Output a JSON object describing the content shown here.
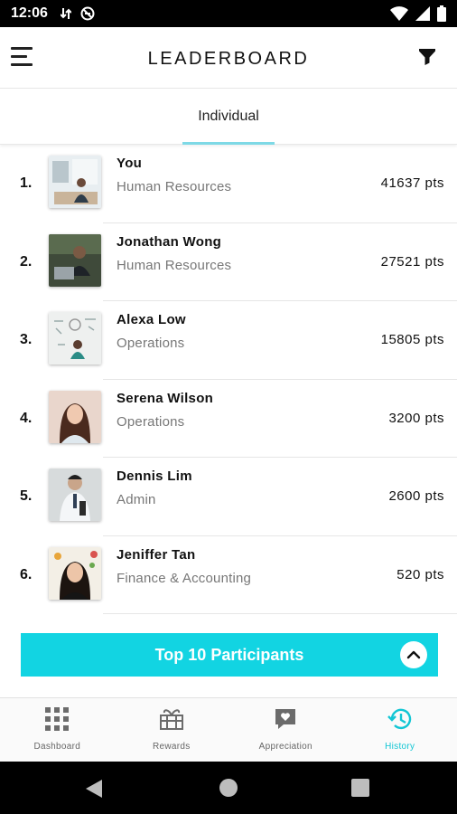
{
  "status_bar": {
    "time": "12:06"
  },
  "header": {
    "title": "LEADERBOARD"
  },
  "tabs": [
    {
      "label": "Individual",
      "active": true
    }
  ],
  "leaderboard": [
    {
      "rank": "1.",
      "name": "You",
      "department": "Human Resources",
      "points": "41637 pts",
      "avatar": "office-desk-photo"
    },
    {
      "rank": "2.",
      "name": "Jonathan Wong",
      "department": "Human Resources",
      "points": "27521 pts",
      "avatar": "man-at-laptop-photo"
    },
    {
      "rank": "3.",
      "name": "Alexa Low",
      "department": "Operations",
      "points": "15805 pts",
      "avatar": "woman-whiteboard-photo"
    },
    {
      "rank": "4.",
      "name": "Serena Wilson",
      "department": "Operations",
      "points": "3200 pts",
      "avatar": "woman-portrait-photo"
    },
    {
      "rank": "5.",
      "name": "Dennis Lim",
      "department": "Admin",
      "points": "2600 pts",
      "avatar": "man-standing-photo"
    },
    {
      "rank": "6.",
      "name": "Jeniffer Tan",
      "department": "Finance & Accounting",
      "points": "520 pts",
      "avatar": "woman-smiling-photo"
    }
  ],
  "cta": {
    "label": "Top 10 Participants",
    "icon": "chevron-up-icon"
  },
  "bottom_nav": [
    {
      "label": "Dashboard",
      "icon": "grid-icon",
      "active": false
    },
    {
      "label": "Rewards",
      "icon": "gift-icon",
      "active": false
    },
    {
      "label": "Appreciation",
      "icon": "heart-chat-icon",
      "active": false
    },
    {
      "label": "History",
      "icon": "history-icon",
      "active": true
    }
  ],
  "colors": {
    "accent": "#12d4e2",
    "tab_indicator": "#7ed9e6",
    "active_nav": "#12c6d4",
    "status_bar": "#000000"
  }
}
